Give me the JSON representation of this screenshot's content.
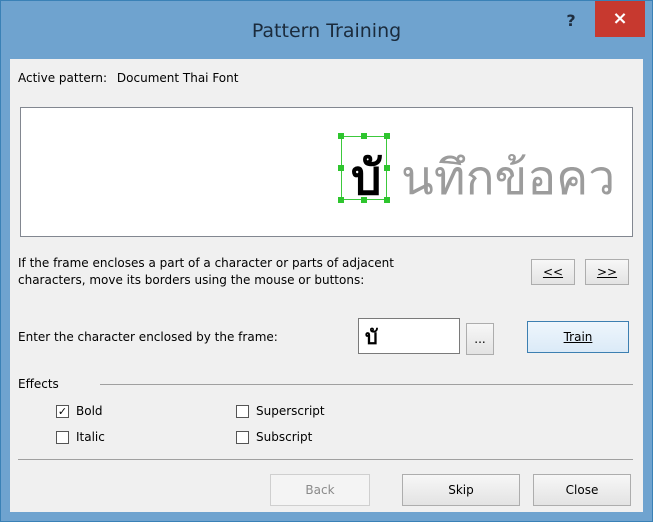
{
  "window": {
    "title": "Pattern Training",
    "help_label": "?",
    "close_label": "×"
  },
  "active_pattern": {
    "label": "Active pattern:",
    "value": "Document Thai Font"
  },
  "preview": {
    "highlighted_char": "บั",
    "remaining_text": "นทึกข้อคว"
  },
  "instructions": {
    "line1": "If the frame encloses a part of a character or parts of adjacent",
    "line2": "characters, move its borders using the mouse or buttons:"
  },
  "nav": {
    "prev_label": "<<",
    "next_label": ">>"
  },
  "enter_char": {
    "label": "Enter the character enclosed by the frame:",
    "value": "บั",
    "browse_label": "...",
    "train_label": "Train"
  },
  "effects": {
    "title": "Effects",
    "bold": {
      "label": "Bold",
      "checked": true
    },
    "italic": {
      "label": "Italic",
      "checked": false
    },
    "superscript": {
      "label": "Superscript",
      "checked": false
    },
    "subscript": {
      "label": "Subscript",
      "checked": false
    }
  },
  "footer": {
    "back_label": "Back",
    "skip_label": "Skip",
    "close_label": "Close"
  }
}
